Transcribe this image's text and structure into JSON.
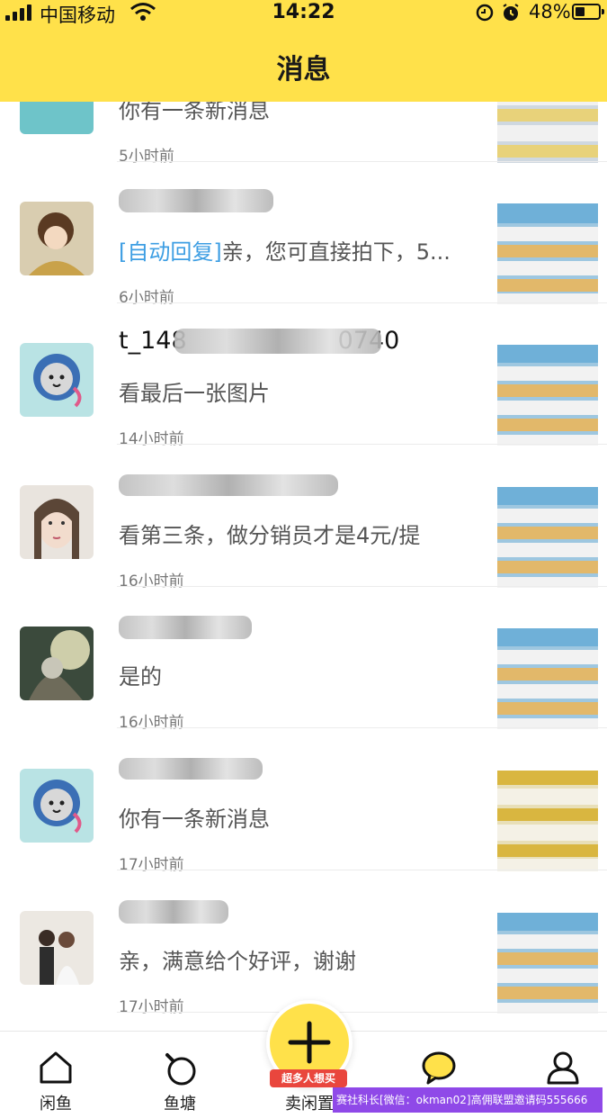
{
  "status_bar": {
    "carrier": "中国移动",
    "time": "14:22",
    "battery_pct": "48%"
  },
  "header": {
    "title": "消息"
  },
  "conversations": [
    {
      "name": "",
      "preview": "你有一条新消息",
      "time": "5小时前"
    },
    {
      "name": "",
      "preview_tag": "[自动回复]",
      "preview": "亲，您可直接拍下，5...",
      "time": "6小时前"
    },
    {
      "name": "t_148",
      "name_tail": "0740",
      "preview": "看最后一张图片",
      "time": "14小时前"
    },
    {
      "name": "",
      "preview": "看第三条，做分销员才是4元/提",
      "time": "16小时前"
    },
    {
      "name": "",
      "preview": "是的",
      "time": "16小时前"
    },
    {
      "name": "",
      "preview": "你有一条新消息",
      "time": "17小时前"
    },
    {
      "name": "",
      "preview": "亲，满意给个好评，谢谢",
      "time": "17小时前"
    }
  ],
  "tabbar": {
    "tabs": [
      {
        "label": "闲鱼",
        "icon": "home-icon"
      },
      {
        "label": "鱼塘",
        "icon": "pond-icon"
      },
      {
        "label": "卖闲置",
        "icon": "plus-icon"
      },
      {
        "label": "",
        "icon": "chat-bubble-icon"
      },
      {
        "label": "",
        "icon": "user-icon"
      }
    ],
    "publish_badge": "超多人想买"
  },
  "watermark": "赛社科长[微信：okman02]高佣联盟邀请码555666",
  "colors": {
    "header_bg": "#ffe14a",
    "accent_blue": "#3d9ee3",
    "badge_red": "#e9463d"
  }
}
